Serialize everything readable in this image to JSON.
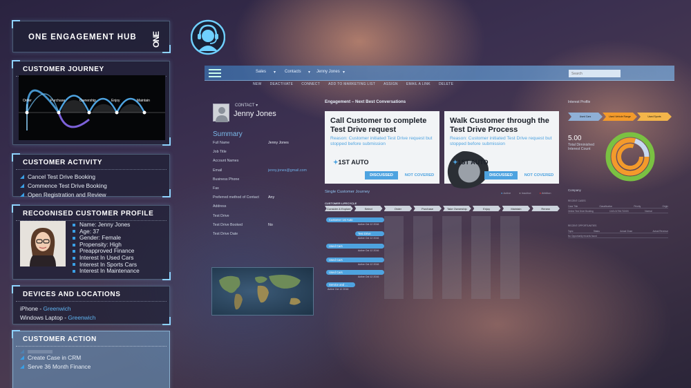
{
  "hub": {
    "title": "ONE ENGAGEMENT HUB",
    "logo": "ONE"
  },
  "journey": {
    "title": "CUSTOMER JOURNEY",
    "stages": [
      "Order",
      "Purchase",
      "Ownership",
      "Enjoy",
      "Maintain"
    ]
  },
  "activity": {
    "title": "CUSTOMER ACTIVITY",
    "items": [
      "Cancel Test Drive Booking",
      "Commence Test Drive Booking",
      "Open Registration and Review"
    ]
  },
  "profile": {
    "title": "RECOGNISED CUSTOMER PROFILE",
    "items": [
      "Name: Jenny Jones",
      "Age: 37",
      "Gender: Female",
      "Propensity: High",
      "Preapproved Finance",
      "Interest In Used Cars",
      "Interest In Sports Cars",
      "Interest In Maintenance"
    ]
  },
  "devices": {
    "title": "DEVICES AND LOCATIONS",
    "items": [
      {
        "device": "iPhone",
        "location": "Greenwich"
      },
      {
        "device": "Windows Laptop",
        "location": "Greenwich"
      }
    ]
  },
  "action": {
    "title": "CUSTOMER ACTION",
    "items": [
      "Create Case in CRM",
      "Serve 36 Month Finance"
    ]
  },
  "crm": {
    "nav": {
      "crumbs": [
        "Sales",
        "Contacts",
        "Jenny Jones"
      ],
      "search_placeholder": "Search"
    },
    "commands": [
      "NEW",
      "DEACTIVATE",
      "CONNECT",
      "ADD TO MARKETING LIST",
      "ASSIGN",
      "EMAIL A LINK",
      "DELETE"
    ],
    "contact": {
      "label": "CONTACT",
      "name": "Jenny Jones",
      "summary_title": "Summary",
      "fields": [
        {
          "k": "Full Name",
          "v": "Jenny Jones"
        },
        {
          "k": "Job Title",
          "v": ""
        },
        {
          "k": "Account Names",
          "v": ""
        },
        {
          "k": "Email",
          "v": "jenny.jones@gmail.com"
        },
        {
          "k": "Business Phone",
          "v": ""
        },
        {
          "k": "Fax",
          "v": ""
        },
        {
          "k": "Preferred method of Contact",
          "v": "Any"
        },
        {
          "k": "Address",
          "v": ""
        },
        {
          "k": "Test Drive",
          "v": ""
        },
        {
          "k": "Test Drive Booked",
          "v": "No"
        },
        {
          "k": "Test Drive Date",
          "v": ""
        }
      ]
    },
    "engagement": {
      "title": "Engagement – Next Best Conversations",
      "cards": [
        {
          "title": "Call Customer to complete Test Drive request",
          "reason": "Reason: Customer initiated Test Drive request but stopped before submission",
          "brand": "1ST AUTO",
          "discussed": "DISCUSSED",
          "not_covered": "NOT COVERED"
        },
        {
          "title": "Walk Customer through the Test Drive Process",
          "reason": "Reason: Customer initiated Test Drive request but stopped before submission",
          "brand": "1ST AUTO",
          "discussed": "DISCUSSED",
          "not_covered": "NOT COVERED"
        }
      ]
    },
    "single_journey": {
      "title": "Single Customer Journey",
      "legend": [
        "Active",
        "Inactive",
        "Attrition"
      ],
      "lifecycle_title": "CUSTOMER LIFECYCLE",
      "stages": [
        "Consider & Explore",
        "Select",
        "Order",
        "Purchase",
        "Take Ownership",
        "Enjoy",
        "Maintain",
        "Renew"
      ],
      "events": [
        {
          "label": "Customer 1st Auto",
          "sub": "Active Oct 12 2016"
        },
        {
          "label": "Test Drive",
          "sub": "Active Oct 12 2016"
        },
        {
          "label": "Used Cars",
          "sub": "Active Oct 12 2016"
        },
        {
          "label": "Used Cars",
          "sub": "Active Oct 12 2016"
        },
        {
          "label": "Used Cars",
          "sub": "Active Oct 12 2016"
        },
        {
          "label": "Service and ...",
          "sub": "Active Oct 12 2016"
        }
      ]
    },
    "interest": {
      "title": "Interest Profile",
      "chevrons": [
        "Used Cars",
        "Used Vehicle Range",
        "Used Sports"
      ],
      "score": "5.00",
      "score_label": "Total Diminished Interest Count",
      "company_label": "Company",
      "recent_cases": "RECENT CASES",
      "recent_opps": "RECENT OPPORTUNITIES",
      "case_headers": [
        "Case Title",
        "Classification",
        "Priority",
        "Origin"
      ],
      "case_row": [
        "Online Test Drive Booking",
        "CAS-01706-T1D0G",
        "Normal",
        ""
      ],
      "opp_headers": [
        "Topic",
        "Status",
        "Actual Close",
        "Actual Revenue"
      ],
      "opp_row": [
        "No Opportunity records found",
        "",
        "",
        ""
      ]
    }
  },
  "colors": {
    "accent": "#4ea3e0",
    "orange": "#f39a2b",
    "green": "#7ac142"
  }
}
